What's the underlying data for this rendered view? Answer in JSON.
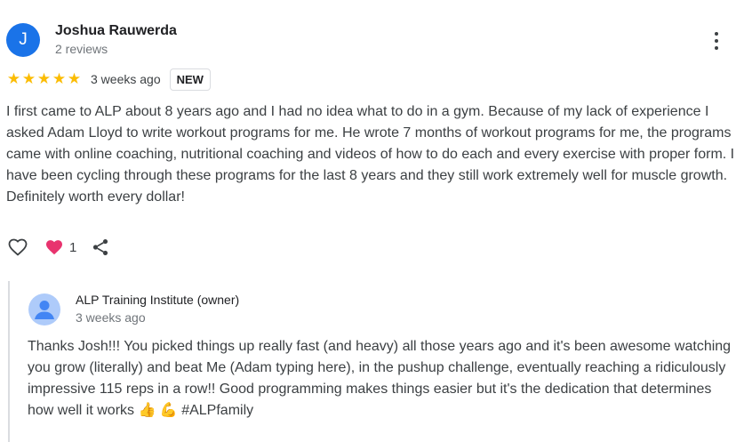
{
  "review": {
    "avatar_initial": "J",
    "author_name": "Joshua Rauwerda",
    "author_meta": "2 reviews",
    "rating": 5,
    "stars": [
      "★",
      "★",
      "★",
      "★",
      "★"
    ],
    "time": "3 weeks ago",
    "badge": "NEW",
    "text": "I first came to ALP about 8 years ago and I had no idea what to do in a gym. Because of my lack of experience I asked Adam Lloyd to write workout programs for me. He wrote 7 months of workout programs for me, the programs came with online coaching, nutritional coaching and videos of how to do each and every exercise with proper form. I have been cycling through these programs for the last 8 years and they still work extremely well for muscle growth. Definitely worth every dollar!",
    "reaction_count": "1",
    "icons": {
      "more": "more-vert-icon",
      "like": "heart-outline-icon",
      "reaction": "heart-reaction-icon",
      "share": "share-icon"
    }
  },
  "reply": {
    "owner_name": "ALP Training Institute (owner)",
    "time": "3 weeks ago",
    "text": "Thanks Josh!!! You picked things up really fast (and heavy) all those years ago and it's been awesome watching you grow (literally) and beat Me (Adam typing here), in the pushup challenge, eventually reaching a ridiculously impressive 115 reps in a row!! Good programming makes things easier but it's the dedication that determines how well it works 👍 💪 #ALPfamily"
  },
  "colors": {
    "avatar_bg": "#1a73e8",
    "star": "#fbbc04",
    "reaction_heart": "#e8336e",
    "owner_avatar_bg": "#aecbfa",
    "owner_avatar_fg": "#4285f4"
  }
}
